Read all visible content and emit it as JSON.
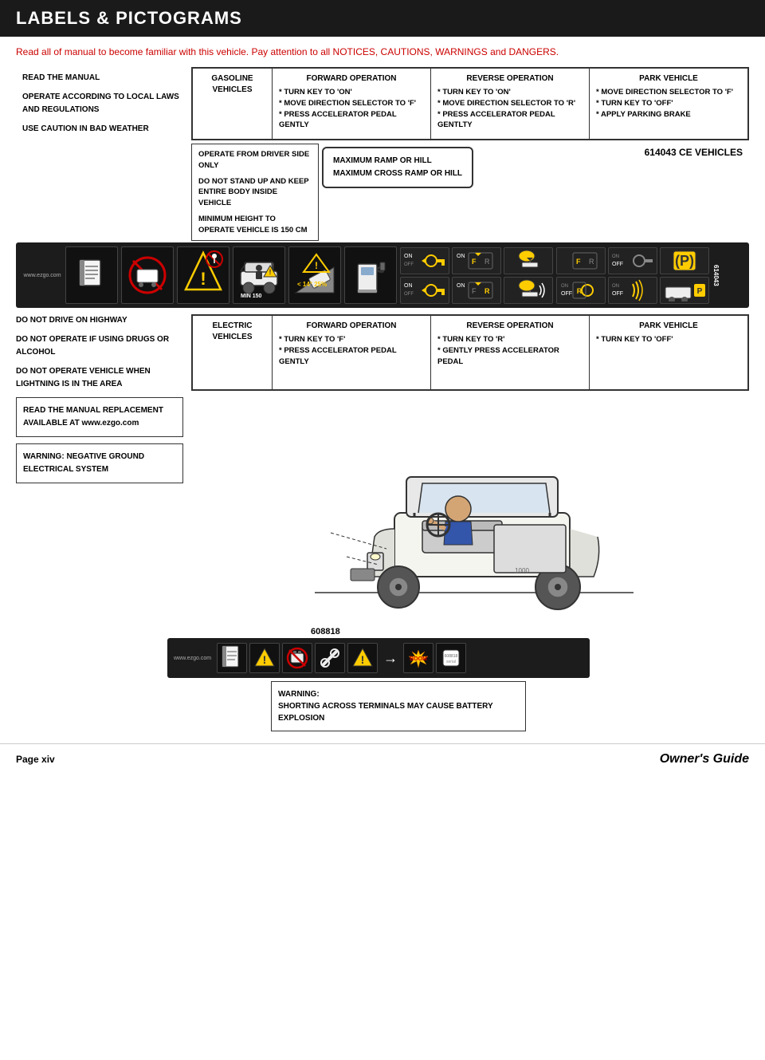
{
  "header": {
    "title": "LABELS & PICTOGRAMS"
  },
  "intro": {
    "line1": "Read all of manual to become familiar with this vehicle. Pay attention to all NOTICES, CAUTIONS, WARNINGS and DANGERS."
  },
  "top_section": {
    "left_warnings": {
      "read_manual": "READ THE MANUAL",
      "operate": "OPERATE ACCORDING TO LOCAL LAWS AND REGULATIONS",
      "caution": "USE CAUTION IN BAD WEATHER"
    },
    "gasoline": {
      "title": "GASOLINE VEHICLES",
      "forward_op": {
        "title": "FORWARD OPERATION",
        "items": [
          "* TURN KEY TO 'ON'",
          "* MOVE DIRECTION SELECTOR TO 'F'",
          "* PRESS ACCELERATOR PEDAL GENTLY"
        ]
      },
      "reverse_op": {
        "title": "REVERSE OPERATION",
        "items": [
          "* TURN KEY TO 'ON'",
          "* MOVE DIRECTION SELECTOR TO 'R'",
          "* PRESS ACCELERATOR PEDAL GENTLTY"
        ]
      },
      "park": {
        "title": "PARK VEHICLE",
        "items": [
          "* MOVE DIRECTION SELECTOR TO 'F'",
          "* TURN KEY TO 'OFF'",
          "* APPLY PARKING BRAKE"
        ]
      }
    }
  },
  "middle_section": {
    "operate_from": "OPERATE FROM DRIVER SIDE ONLY",
    "do_not_stand": "DO NOT STAND UP AND KEEP ENTIRE BODY INSIDE VEHICLE",
    "minimum_height": "MINIMUM HEIGHT TO OPERATE VEHICLE IS 150 CM",
    "ramp": {
      "line1": "MAXIMUM RAMP OR HILL",
      "line2": "MAXIMUM CROSS RAMP OR HILL"
    },
    "ce_label": "614043  CE VEHICLES"
  },
  "second_section": {
    "left": {
      "highway": "DO NOT DRIVE ON HIGHWAY",
      "drugs": "DO NOT OPERATE IF USING DRUGS OR ALCOHOL",
      "lightning": "DO NOT OPERATE VEHICLE WHEN LIGHTNING IS IN THE AREA"
    },
    "electric": {
      "title": "ELECTRIC VEHICLES",
      "forward_op": {
        "title": "FORWARD OPERATION",
        "items": [
          "* TURN KEY TO 'F'",
          "* PRESS ACCELERATOR PEDAL GENTLY"
        ]
      },
      "reverse_op": {
        "title": "REVERSE OPERATION",
        "items": [
          "* TURN KEY TO 'R'",
          "* GENTLY PRESS ACCELERATOR PEDAL"
        ]
      },
      "park": {
        "title": "PARK VEHICLE",
        "items": [
          "* TURN KEY TO 'OFF'"
        ]
      }
    }
  },
  "bottom_section": {
    "read_manual_box": {
      "line1": "READ THE MANUAL REPLACEMENT AVAILABLE AT www.ezgo.com"
    },
    "warning_box": {
      "title": "WARNING:",
      "line1": "NEGATIVE GROUND ELECTRICAL SYSTEM"
    },
    "strip_label": "608818",
    "strip_site": "www.ezgo.com",
    "battery_warning": {
      "title": "WARNING:",
      "line1": "SHORTING ACROSS TERMINALS MAY CAUSE BATTERY EXPLOSION"
    }
  },
  "footer": {
    "page": "Page xiv",
    "guide": "Owner's Guide"
  },
  "icons": {
    "book": "📖",
    "no_entry": "🚫",
    "warning": "⚠",
    "lightning": "⚡",
    "parking": "P"
  }
}
